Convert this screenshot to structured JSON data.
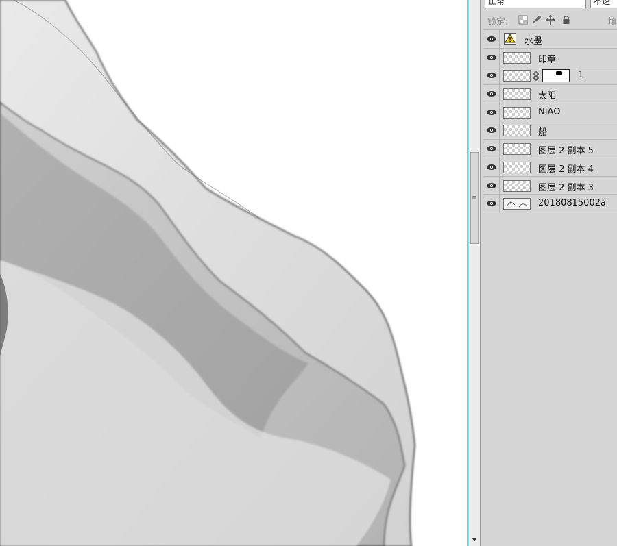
{
  "layers_panel": {
    "blend_mode": "正常",
    "opacity_label": "不透",
    "lock_label": "锁定:",
    "fill_label": "填",
    "lock_icons": [
      "lock-transparent-pixels-icon",
      "lock-image-pixels-icon",
      "lock-position-icon",
      "lock-all-icon"
    ],
    "layers": [
      {
        "name": "水墨",
        "thumb": "warning-icon",
        "visible": true
      },
      {
        "name": "印章",
        "thumb": "transparent",
        "visible": true
      },
      {
        "name": "1",
        "thumb": "transparent",
        "has_mask": true,
        "visible": true
      },
      {
        "name": "太阳",
        "thumb": "transparent",
        "visible": true
      },
      {
        "name": "NIAO",
        "thumb": "transparent",
        "visible": true
      },
      {
        "name": "船",
        "thumb": "transparent",
        "visible": true
      },
      {
        "name": "图层 2 副本 5",
        "thumb": "transparent",
        "visible": true
      },
      {
        "name": "图层 2 副本 4",
        "thumb": "transparent",
        "visible": true
      },
      {
        "name": "图层 2 副本 3",
        "thumb": "transparent",
        "visible": true
      },
      {
        "name": "20180815002a",
        "thumb": "photo",
        "visible": true
      }
    ]
  },
  "colors": {
    "guide": "#5fd6dc",
    "panel_bg": "#d6d6d6",
    "canvas_bg": "#ffffff"
  }
}
